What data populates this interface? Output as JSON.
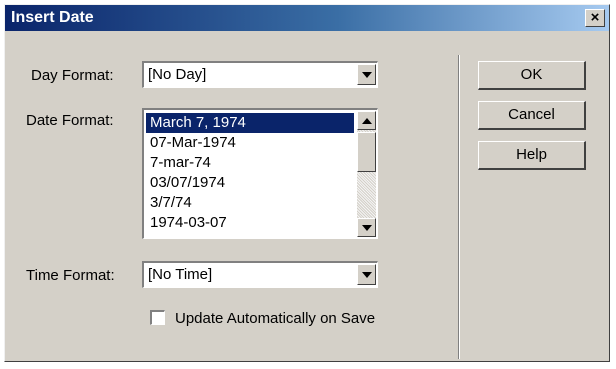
{
  "window": {
    "title": "Insert Date",
    "close_symbol": "×"
  },
  "day_format": {
    "label": "Day Format:",
    "value": "[No Day]"
  },
  "date_format": {
    "label": "Date Format:",
    "options": [
      "March 7, 1974",
      "07-Mar-1974",
      "7-mar-74",
      "03/07/1974",
      "3/7/74",
      "1974-03-07"
    ],
    "selected_index": 0
  },
  "time_format": {
    "label": "Time Format:",
    "value": "[No Time]"
  },
  "update_checkbox": {
    "label": "Update Automatically on Save",
    "checked": false
  },
  "buttons": {
    "ok": "OK",
    "cancel": "Cancel",
    "help": "Help"
  },
  "colors": {
    "title_bar": "#0a246a",
    "selection": "#0a246a",
    "face": "#d4d0c8"
  }
}
